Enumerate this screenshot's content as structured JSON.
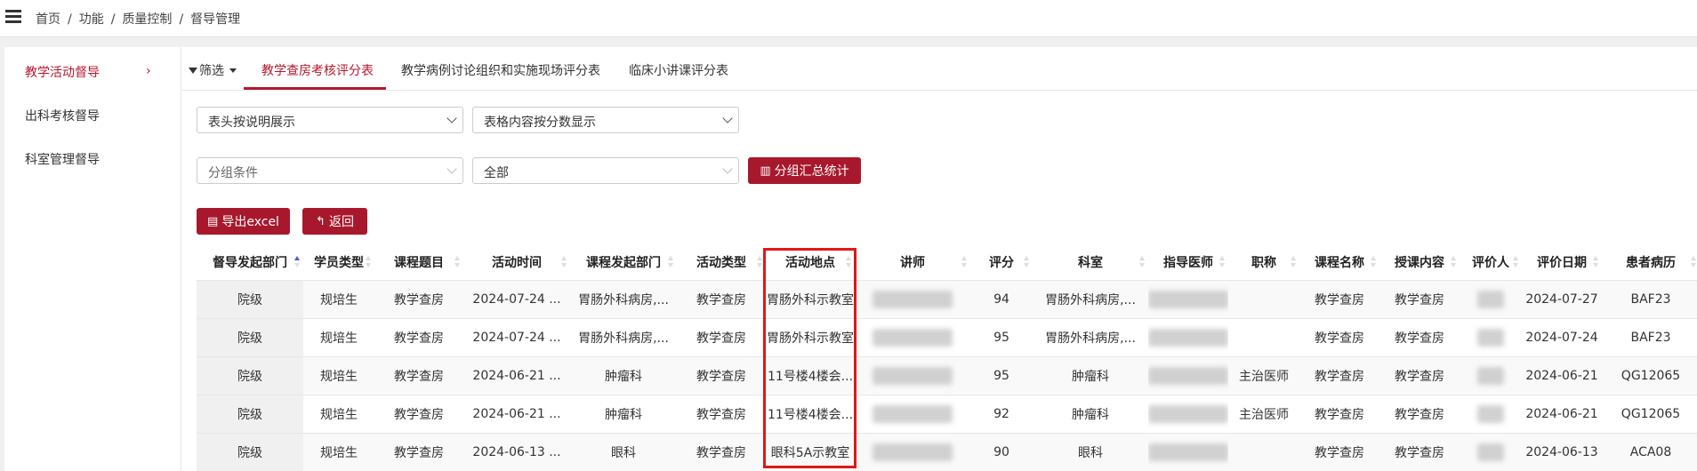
{
  "breadcrumb": [
    "首页",
    "功能",
    "质量控制",
    "督导管理"
  ],
  "sidebar": {
    "items": [
      {
        "label": "教学活动督导",
        "active": true
      },
      {
        "label": "出科考核督导",
        "active": false
      },
      {
        "label": "科室管理督导",
        "active": false
      }
    ]
  },
  "tabs": {
    "filter_label": "筛选",
    "items": [
      "教学查房考核评分表",
      "教学病例讨论组织和实施现场评分表",
      "临床小讲课评分表"
    ],
    "active": 0
  },
  "controls": {
    "header_mode": "表头按说明展示",
    "content_mode": "表格内容按分数显示",
    "group_placeholder": "分组条件",
    "group_value": "全部",
    "group_stats_button": "分组汇总统计",
    "export_button": "导出excel",
    "back_button": "返回"
  },
  "table": {
    "columns": [
      "督导发起部门",
      "学员类型",
      "课程题目",
      "活动时间",
      "课程发起部门",
      "活动类型",
      "活动地点",
      "讲师",
      "评分",
      "科室",
      "指导医师",
      "职称",
      "课程名称",
      "授课内容",
      "评价人",
      "评价日期",
      "患者病历"
    ],
    "sorted_column": 0,
    "rows": [
      [
        "院级",
        "规培生",
        "教学查房",
        "2024-07-24 ...",
        "胃肠外科病房,...",
        "教学查房",
        "胃肠外科示教室",
        "",
        "94",
        "胃肠外科病房,...",
        "",
        "",
        "教学查房",
        "教学查房",
        "",
        "2024-07-27",
        "BAF23"
      ],
      [
        "院级",
        "规培生",
        "教学查房",
        "2024-07-24 ...",
        "胃肠外科病房,...",
        "教学查房",
        "胃肠外科示教室",
        "",
        "95",
        "胃肠外科病房,...",
        "",
        "",
        "教学查房",
        "教学查房",
        "",
        "2024-07-24",
        "BAF23"
      ],
      [
        "院级",
        "规培生",
        "教学查房",
        "2024-06-21 ...",
        "肿瘤科",
        "教学查房",
        "11号楼4楼会...",
        "",
        "95",
        "肿瘤科",
        "",
        "主治医师",
        "教学查房",
        "教学查房",
        "",
        "2024-06-21",
        "QG12065"
      ],
      [
        "院级",
        "规培生",
        "教学查房",
        "2024-06-21 ...",
        "肿瘤科",
        "教学查房",
        "11号楼4楼会...",
        "",
        "92",
        "肿瘤科",
        "",
        "主治医师",
        "教学查房",
        "教学查房",
        "",
        "2024-06-21",
        "QG12065"
      ],
      [
        "院级",
        "规培生",
        "教学查房",
        "2024-06-13 ...",
        "眼科",
        "教学查房",
        "眼科5A示教室",
        "",
        "90",
        "眼科",
        "",
        "",
        "教学查房",
        "教学查房",
        "",
        "2024-06-13",
        "ACA08"
      ]
    ]
  },
  "colors": {
    "accent": "#a8182c",
    "highlight_box": "#e01818",
    "sort_active": "#4a5ccc"
  }
}
